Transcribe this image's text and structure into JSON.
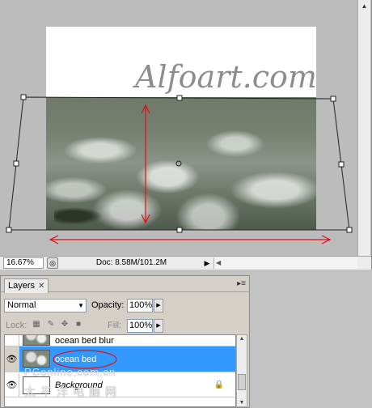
{
  "document": {
    "watermark_text": "Alfoart.com",
    "zoom": "16.67%",
    "doc_info": "Doc: 8.58M/101.2M"
  },
  "layers_panel": {
    "tab_label": "Layers",
    "blend_mode": "Normal",
    "opacity_label": "Opacity:",
    "opacity_value": "100%",
    "lock_label": "Lock:",
    "fill_label": "Fill:",
    "fill_value": "100%",
    "layers": [
      {
        "name": "ocean bed blur",
        "visible": false,
        "selected": false
      },
      {
        "name": "ocean bed",
        "visible": true,
        "selected": true
      },
      {
        "name": "Background",
        "visible": true,
        "selected": false,
        "locked": true
      }
    ]
  },
  "site_watermark": {
    "line1": "PConline.com.cn",
    "line2": "太平洋电脑网"
  },
  "colors": {
    "selection": "#3399ff",
    "annotation_red": "#e01010",
    "panel_bg": "#d4d0c8"
  },
  "icons": {
    "visibility": "eye-icon",
    "lock": "lock-icon",
    "close": "close-icon",
    "panel_menu": "panel-menu-icon"
  }
}
